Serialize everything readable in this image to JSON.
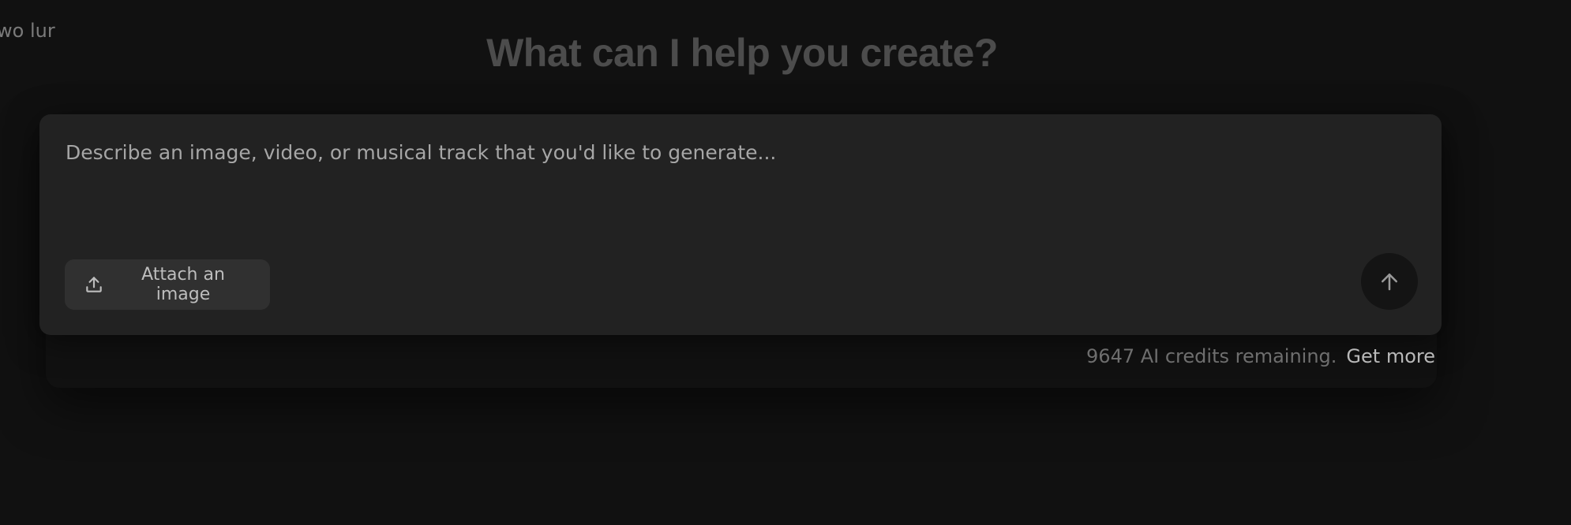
{
  "corner_text": "wo lur",
  "headline": "What can I help you create?",
  "prompt": {
    "placeholder": "Describe an image, video, or musical track that you'd like to generate...",
    "value": ""
  },
  "attach_button": {
    "label": "Attach an image",
    "icon": "upload-icon"
  },
  "send_button": {
    "icon": "arrow-up-icon"
  },
  "credits": {
    "text": "9647 AI credits remaining.",
    "get_more_label": "Get more"
  },
  "colors": {
    "background": "#111111",
    "card": "#222222",
    "button": "#303030",
    "send_button": "#141414",
    "headline": "#4c4c4c"
  }
}
